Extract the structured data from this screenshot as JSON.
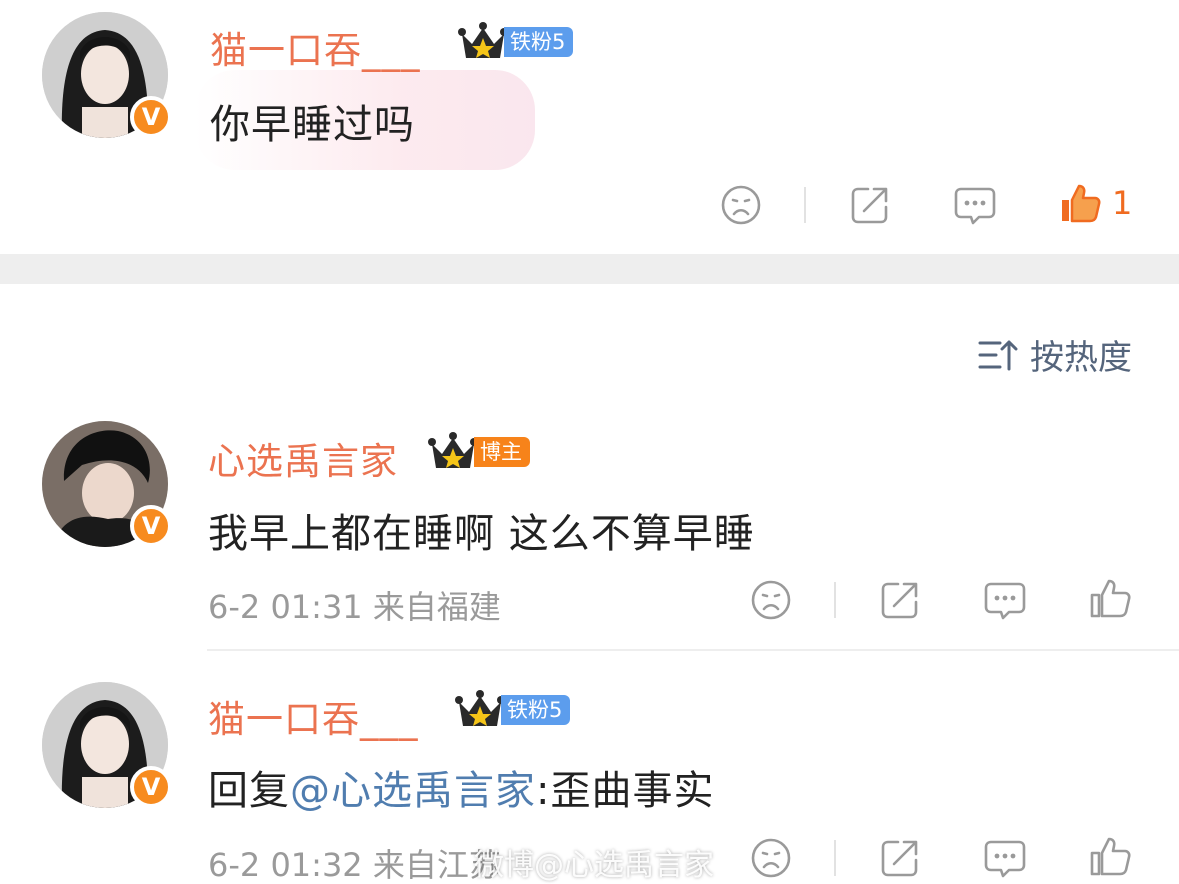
{
  "comments": [
    {
      "username": "猫一口吞___",
      "tag": "铁粉5",
      "verified": "V",
      "text": "你早睡过吗",
      "like_count": "1"
    },
    {
      "username": "心选禹言家",
      "tag": "博主",
      "verified": "V",
      "text": "我早上都在睡啊 这么不算早睡",
      "meta": "6-2 01:31  来自福建"
    },
    {
      "username": "猫一口吞___",
      "tag": "铁粉5",
      "verified": "V",
      "reply_prefix": "回复",
      "reply_mention": "@心选禹言家",
      "reply_text": ":歪曲事实",
      "meta": "6-2 01:32  来自江苏"
    }
  ],
  "sort": {
    "label": "按热度",
    "icon": "sort-icon"
  },
  "watermark": "微博@心选禹言家",
  "colors": {
    "username": "#eb7350",
    "mention": "#507daf",
    "like_active": "#f06b20",
    "fan_tag": "#5c9ded",
    "blogger_tag": "#f7831a"
  }
}
